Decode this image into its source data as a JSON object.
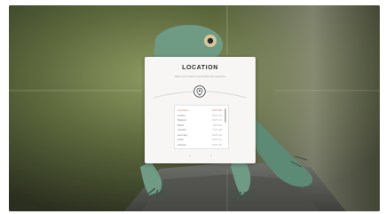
{
  "dialog": {
    "title": "LOCATION",
    "subtitle": "Select your location to personalize the experience",
    "pin_icon": "map-pin-icon",
    "list": {
      "rows": [
        {
          "name": "Anywhere",
          "value": "GMT+00",
          "selected": true
        },
        {
          "name": "Austria",
          "value": "GMT+01"
        },
        {
          "name": "Belgium",
          "value": "GMT+01"
        },
        {
          "name": "Brazil",
          "value": "GMT-03"
        },
        {
          "name": "Canada",
          "value": "GMT-05"
        },
        {
          "name": "Germany",
          "value": "GMT+01"
        },
        {
          "name": "Spain",
          "value": "GMT+01"
        },
        {
          "name": "Sweden",
          "value": "GMT+01"
        }
      ]
    },
    "pager": {
      "prev": "‹",
      "next": "›"
    }
  },
  "colors": {
    "accent": "#e07b5a",
    "dialog_bg": "#f7f6f4"
  }
}
